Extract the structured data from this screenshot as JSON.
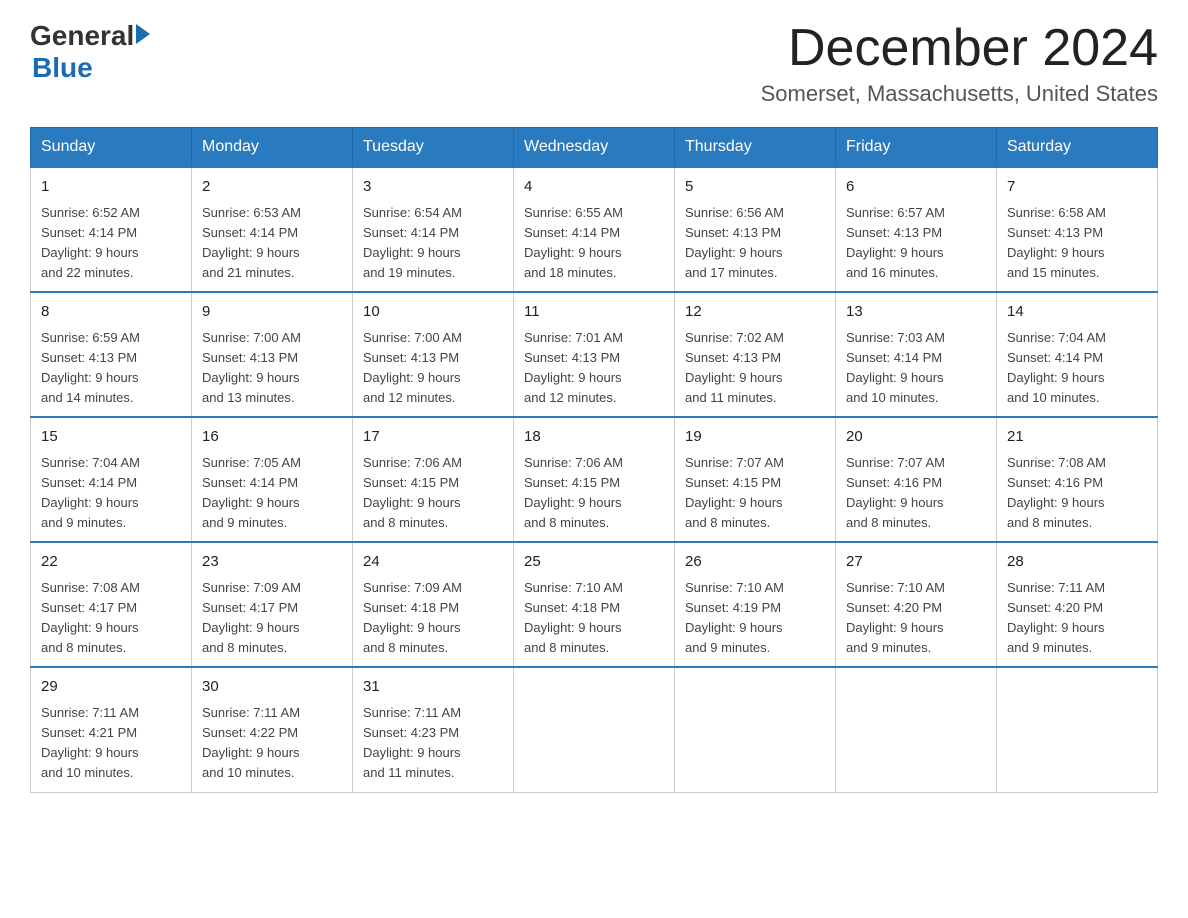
{
  "logo": {
    "general": "General",
    "arrow": "▶",
    "blue": "Blue"
  },
  "title": {
    "month": "December 2024",
    "location": "Somerset, Massachusetts, United States"
  },
  "weekdays": [
    "Sunday",
    "Monday",
    "Tuesday",
    "Wednesday",
    "Thursday",
    "Friday",
    "Saturday"
  ],
  "weeks": [
    [
      {
        "day": "1",
        "sunrise": "6:52 AM",
        "sunset": "4:14 PM",
        "daylight": "9 hours and 22 minutes."
      },
      {
        "day": "2",
        "sunrise": "6:53 AM",
        "sunset": "4:14 PM",
        "daylight": "9 hours and 21 minutes."
      },
      {
        "day": "3",
        "sunrise": "6:54 AM",
        "sunset": "4:14 PM",
        "daylight": "9 hours and 19 minutes."
      },
      {
        "day": "4",
        "sunrise": "6:55 AM",
        "sunset": "4:14 PM",
        "daylight": "9 hours and 18 minutes."
      },
      {
        "day": "5",
        "sunrise": "6:56 AM",
        "sunset": "4:13 PM",
        "daylight": "9 hours and 17 minutes."
      },
      {
        "day": "6",
        "sunrise": "6:57 AM",
        "sunset": "4:13 PM",
        "daylight": "9 hours and 16 minutes."
      },
      {
        "day": "7",
        "sunrise": "6:58 AM",
        "sunset": "4:13 PM",
        "daylight": "9 hours and 15 minutes."
      }
    ],
    [
      {
        "day": "8",
        "sunrise": "6:59 AM",
        "sunset": "4:13 PM",
        "daylight": "9 hours and 14 minutes."
      },
      {
        "day": "9",
        "sunrise": "7:00 AM",
        "sunset": "4:13 PM",
        "daylight": "9 hours and 13 minutes."
      },
      {
        "day": "10",
        "sunrise": "7:00 AM",
        "sunset": "4:13 PM",
        "daylight": "9 hours and 12 minutes."
      },
      {
        "day": "11",
        "sunrise": "7:01 AM",
        "sunset": "4:13 PM",
        "daylight": "9 hours and 12 minutes."
      },
      {
        "day": "12",
        "sunrise": "7:02 AM",
        "sunset": "4:13 PM",
        "daylight": "9 hours and 11 minutes."
      },
      {
        "day": "13",
        "sunrise": "7:03 AM",
        "sunset": "4:14 PM",
        "daylight": "9 hours and 10 minutes."
      },
      {
        "day": "14",
        "sunrise": "7:04 AM",
        "sunset": "4:14 PM",
        "daylight": "9 hours and 10 minutes."
      }
    ],
    [
      {
        "day": "15",
        "sunrise": "7:04 AM",
        "sunset": "4:14 PM",
        "daylight": "9 hours and 9 minutes."
      },
      {
        "day": "16",
        "sunrise": "7:05 AM",
        "sunset": "4:14 PM",
        "daylight": "9 hours and 9 minutes."
      },
      {
        "day": "17",
        "sunrise": "7:06 AM",
        "sunset": "4:15 PM",
        "daylight": "9 hours and 8 minutes."
      },
      {
        "day": "18",
        "sunrise": "7:06 AM",
        "sunset": "4:15 PM",
        "daylight": "9 hours and 8 minutes."
      },
      {
        "day": "19",
        "sunrise": "7:07 AM",
        "sunset": "4:15 PM",
        "daylight": "9 hours and 8 minutes."
      },
      {
        "day": "20",
        "sunrise": "7:07 AM",
        "sunset": "4:16 PM",
        "daylight": "9 hours and 8 minutes."
      },
      {
        "day": "21",
        "sunrise": "7:08 AM",
        "sunset": "4:16 PM",
        "daylight": "9 hours and 8 minutes."
      }
    ],
    [
      {
        "day": "22",
        "sunrise": "7:08 AM",
        "sunset": "4:17 PM",
        "daylight": "9 hours and 8 minutes."
      },
      {
        "day": "23",
        "sunrise": "7:09 AM",
        "sunset": "4:17 PM",
        "daylight": "9 hours and 8 minutes."
      },
      {
        "day": "24",
        "sunrise": "7:09 AM",
        "sunset": "4:18 PM",
        "daylight": "9 hours and 8 minutes."
      },
      {
        "day": "25",
        "sunrise": "7:10 AM",
        "sunset": "4:18 PM",
        "daylight": "9 hours and 8 minutes."
      },
      {
        "day": "26",
        "sunrise": "7:10 AM",
        "sunset": "4:19 PM",
        "daylight": "9 hours and 9 minutes."
      },
      {
        "day": "27",
        "sunrise": "7:10 AM",
        "sunset": "4:20 PM",
        "daylight": "9 hours and 9 minutes."
      },
      {
        "day": "28",
        "sunrise": "7:11 AM",
        "sunset": "4:20 PM",
        "daylight": "9 hours and 9 minutes."
      }
    ],
    [
      {
        "day": "29",
        "sunrise": "7:11 AM",
        "sunset": "4:21 PM",
        "daylight": "9 hours and 10 minutes."
      },
      {
        "day": "30",
        "sunrise": "7:11 AM",
        "sunset": "4:22 PM",
        "daylight": "9 hours and 10 minutes."
      },
      {
        "day": "31",
        "sunrise": "7:11 AM",
        "sunset": "4:23 PM",
        "daylight": "9 hours and 11 minutes."
      },
      null,
      null,
      null,
      null
    ]
  ],
  "labels": {
    "sunrise": "Sunrise:",
    "sunset": "Sunset:",
    "daylight": "Daylight:"
  }
}
